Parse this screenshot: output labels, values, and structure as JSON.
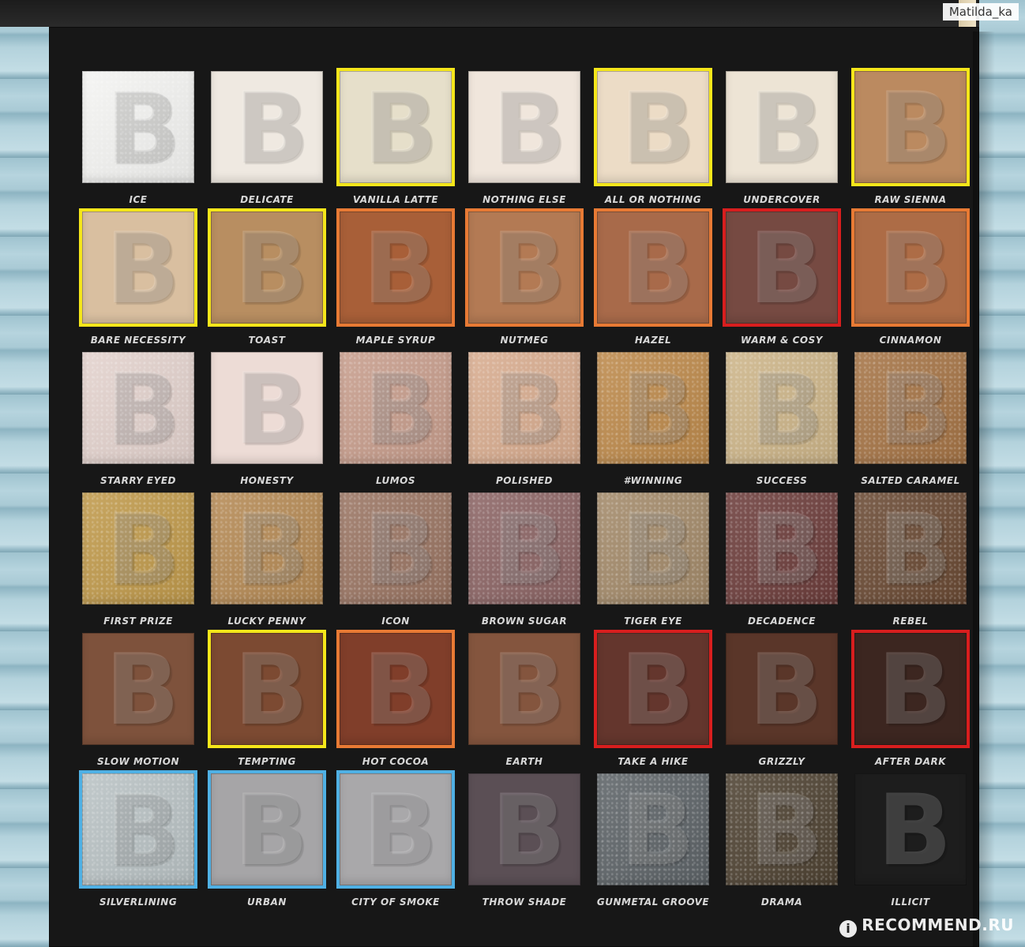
{
  "watermarks": {
    "top_right": "Matilda_ka",
    "bottom_right": "RECOMMEND.RU",
    "bottom_logo": "i"
  },
  "emboss_letter": "B",
  "colors": {
    "yellow_highlight": "#f5e61a",
    "orange_highlight": "#e87a34",
    "red_highlight": "#d81e1e",
    "blue_highlight": "#4fb0e4"
  },
  "shades": [
    {
      "name": "ICE",
      "color": "#f4f4f2",
      "finish": "shimmer",
      "highlight": ""
    },
    {
      "name": "DELICATE",
      "color": "#efe9e1",
      "finish": "matte",
      "highlight": ""
    },
    {
      "name": "VANILLA LATTE",
      "color": "#e6dfca",
      "finish": "matte",
      "highlight": "yellow"
    },
    {
      "name": "NOTHING ELSE",
      "color": "#f0e6dc",
      "finish": "matte",
      "highlight": ""
    },
    {
      "name": "ALL OR NOTHING",
      "color": "#ecdcc6",
      "finish": "matte",
      "highlight": "yellow"
    },
    {
      "name": "UNDERCOVER",
      "color": "#ede4d5",
      "finish": "matte",
      "highlight": ""
    },
    {
      "name": "RAW SIENNA",
      "color": "#bb8a60",
      "finish": "matte",
      "highlight": "yellow"
    },
    {
      "name": "BARE NECESSITY",
      "color": "#d9bfa0",
      "finish": "matte",
      "highlight": "yellow"
    },
    {
      "name": "TOAST",
      "color": "#b88e61",
      "finish": "matte",
      "highlight": "yellow"
    },
    {
      "name": "MAPLE SYRUP",
      "color": "#a85f38",
      "finish": "matte",
      "highlight": "orange"
    },
    {
      "name": "NUTMEG",
      "color": "#b37a54",
      "finish": "matte",
      "highlight": "orange"
    },
    {
      "name": "HAZEL",
      "color": "#a86a4a",
      "finish": "matte",
      "highlight": "orange"
    },
    {
      "name": "WARM & COSY",
      "color": "#764a42",
      "finish": "matte",
      "highlight": "red"
    },
    {
      "name": "CINNAMON",
      "color": "#ad6c46",
      "finish": "matte",
      "highlight": "orange"
    },
    {
      "name": "STARRY EYED",
      "color": "#e3d2cd",
      "finish": "shimmer",
      "highlight": ""
    },
    {
      "name": "HONESTY",
      "color": "#eddcd6",
      "finish": "matte",
      "highlight": ""
    },
    {
      "name": "LUMOS",
      "color": "#c79d8c",
      "finish": "shimmer",
      "highlight": ""
    },
    {
      "name": "POLISHED",
      "color": "#d8ac8f",
      "finish": "shimmer",
      "highlight": ""
    },
    {
      "name": "#WINNING",
      "color": "#bd8a4c",
      "finish": "shimmer",
      "highlight": ""
    },
    {
      "name": "SUCCESS",
      "color": "#cdb589",
      "finish": "shimmer",
      "highlight": ""
    },
    {
      "name": "SALTED CARAMEL",
      "color": "#a57446",
      "finish": "shimmer",
      "highlight": ""
    },
    {
      "name": "FIRST PRIZE",
      "color": "#c09a4c",
      "finish": "shimmer",
      "highlight": ""
    },
    {
      "name": "LUCKY PENNY",
      "color": "#b58a55",
      "finish": "shimmer",
      "highlight": ""
    },
    {
      "name": "ICON",
      "color": "#9a7563",
      "finish": "shimmer",
      "highlight": ""
    },
    {
      "name": "BROWN SUGAR",
      "color": "#8c6565",
      "finish": "shimmer",
      "highlight": ""
    },
    {
      "name": "TIGER EYE",
      "color": "#a38a6a",
      "finish": "shimmer",
      "highlight": ""
    },
    {
      "name": "DECADENCE",
      "color": "#6d3e3c",
      "finish": "shimmer",
      "highlight": ""
    },
    {
      "name": "REBEL",
      "color": "#6a4a34",
      "finish": "shimmer",
      "highlight": ""
    },
    {
      "name": "SLOW MOTION",
      "color": "#7e523c",
      "finish": "matte",
      "highlight": ""
    },
    {
      "name": "TEMPTING",
      "color": "#7c4a32",
      "finish": "matte",
      "highlight": "yellow"
    },
    {
      "name": "HOT COCOA",
      "color": "#803e2a",
      "finish": "matte",
      "highlight": "orange"
    },
    {
      "name": "EARTH",
      "color": "#84553e",
      "finish": "matte",
      "highlight": ""
    },
    {
      "name": "TAKE A HIKE",
      "color": "#64362d",
      "finish": "matte",
      "highlight": "red"
    },
    {
      "name": "GRIZZLY",
      "color": "#5a3629",
      "finish": "matte",
      "highlight": ""
    },
    {
      "name": "AFTER DARK",
      "color": "#3c2620",
      "finish": "matte",
      "highlight": "red"
    },
    {
      "name": "SILVERLINING",
      "color": "#b9c2c4",
      "finish": "shimmer",
      "highlight": "blue"
    },
    {
      "name": "URBAN",
      "color": "#a6a5a7",
      "finish": "matte",
      "highlight": "blue"
    },
    {
      "name": "CITY OF SMOKE",
      "color": "#a9a8aa",
      "finish": "matte",
      "highlight": "blue"
    },
    {
      "name": "THROW SHADE",
      "color": "#5b4f55",
      "finish": "matte",
      "highlight": ""
    },
    {
      "name": "GUNMETAL GROOVE",
      "color": "#5e6468",
      "finish": "shimmer",
      "highlight": ""
    },
    {
      "name": "DRAMA",
      "color": "#4f4333",
      "finish": "shimmer",
      "highlight": ""
    },
    {
      "name": "ILLICIT",
      "color": "#1d1d1d",
      "finish": "matte",
      "highlight": ""
    }
  ]
}
